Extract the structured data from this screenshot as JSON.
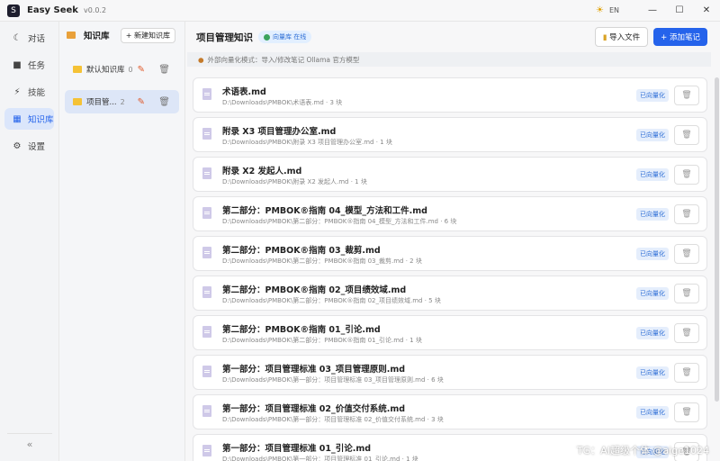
{
  "titlebar": {
    "logo_glyph": "S",
    "app_name": "Easy Seek",
    "version": "v0.0.2",
    "lang": "EN",
    "minimize": "—",
    "maximize": "☐",
    "close": "✕"
  },
  "nav": {
    "items": [
      {
        "label": "对话",
        "icon": "chat-icon",
        "glyph": "☾",
        "active": false
      },
      {
        "label": "任务",
        "icon": "task-icon",
        "glyph": "■",
        "active": false
      },
      {
        "label": "技能",
        "icon": "skill-icon",
        "glyph": "⚡",
        "active": false
      },
      {
        "label": "知识库",
        "icon": "knowledge-icon",
        "glyph": "▦",
        "active": true
      },
      {
        "label": "设置",
        "icon": "settings-icon",
        "glyph": "⚙",
        "active": false
      }
    ],
    "collapse": "«"
  },
  "kb_panel": {
    "title": "知识库",
    "new_button": "+ 新建知识库",
    "items": [
      {
        "name": "默认知识库",
        "count": "0",
        "active": false
      },
      {
        "name": "项目管...",
        "count": "2",
        "active": true
      }
    ]
  },
  "main": {
    "title": "项目管理知识",
    "vector_badge": "向量库 在线",
    "import_button": "导入文件",
    "add_note_button": "+ 添加笔记",
    "hint": "外部向量化模式：导入/修改笔记 Ollama 官方模型"
  },
  "documents": [
    {
      "name": "术语表.md",
      "path": "D:\\Downloads\\PMBOK\\术语表.md · 3 块",
      "status": "已向量化"
    },
    {
      "name": "附录 X3 项目管理办公室.md",
      "path": "D:\\Downloads\\PMBOK\\附录 X3 项目管理办公室.md · 1 块",
      "status": "已向量化"
    },
    {
      "name": "附录 X2 发起人.md",
      "path": "D:\\Downloads\\PMBOK\\附录 X2 发起人.md · 1 块",
      "status": "已向量化"
    },
    {
      "name": "第二部分：PMBOK®指南 04_模型_方法和工件.md",
      "path": "D:\\Downloads\\PMBOK\\第二部分：PMBOK®指南 04_模型_方法和工件.md · 6 块",
      "status": "已向量化"
    },
    {
      "name": "第二部分：PMBOK®指南 03_裁剪.md",
      "path": "D:\\Downloads\\PMBOK\\第二部分：PMBOK®指南 03_裁剪.md · 2 块",
      "status": "已向量化"
    },
    {
      "name": "第二部分：PMBOK®指南 02_项目绩效域.md",
      "path": "D:\\Downloads\\PMBOK\\第二部分：PMBOK®指南 02_项目绩效域.md · 5 块",
      "status": "已向量化"
    },
    {
      "name": "第二部分：PMBOK®指南 01_引论.md",
      "path": "D:\\Downloads\\PMBOK\\第二部分：PMBOK®指南 01_引论.md · 1 块",
      "status": "已向量化"
    },
    {
      "name": "第一部分：项目管理标准 03_项目管理原则.md",
      "path": "D:\\Downloads\\PMBOK\\第一部分：项目管理标准 03_项目管理原则.md · 6 块",
      "status": "已向量化"
    },
    {
      "name": "第一部分：项目管理标准 02_价值交付系统.md",
      "path": "D:\\Downloads\\PMBOK\\第一部分：项目管理标准 02_价值交付系统.md · 3 块",
      "status": "已向量化"
    },
    {
      "name": "第一部分：项目管理标准 01_引论.md",
      "path": "D:\\Downloads\\PMBOK\\第一部分：项目管理标准 01_引论.md · 1 块",
      "status": "已向量化"
    }
  ],
  "watermark": "TG：AI超级个体 @aige1024"
}
